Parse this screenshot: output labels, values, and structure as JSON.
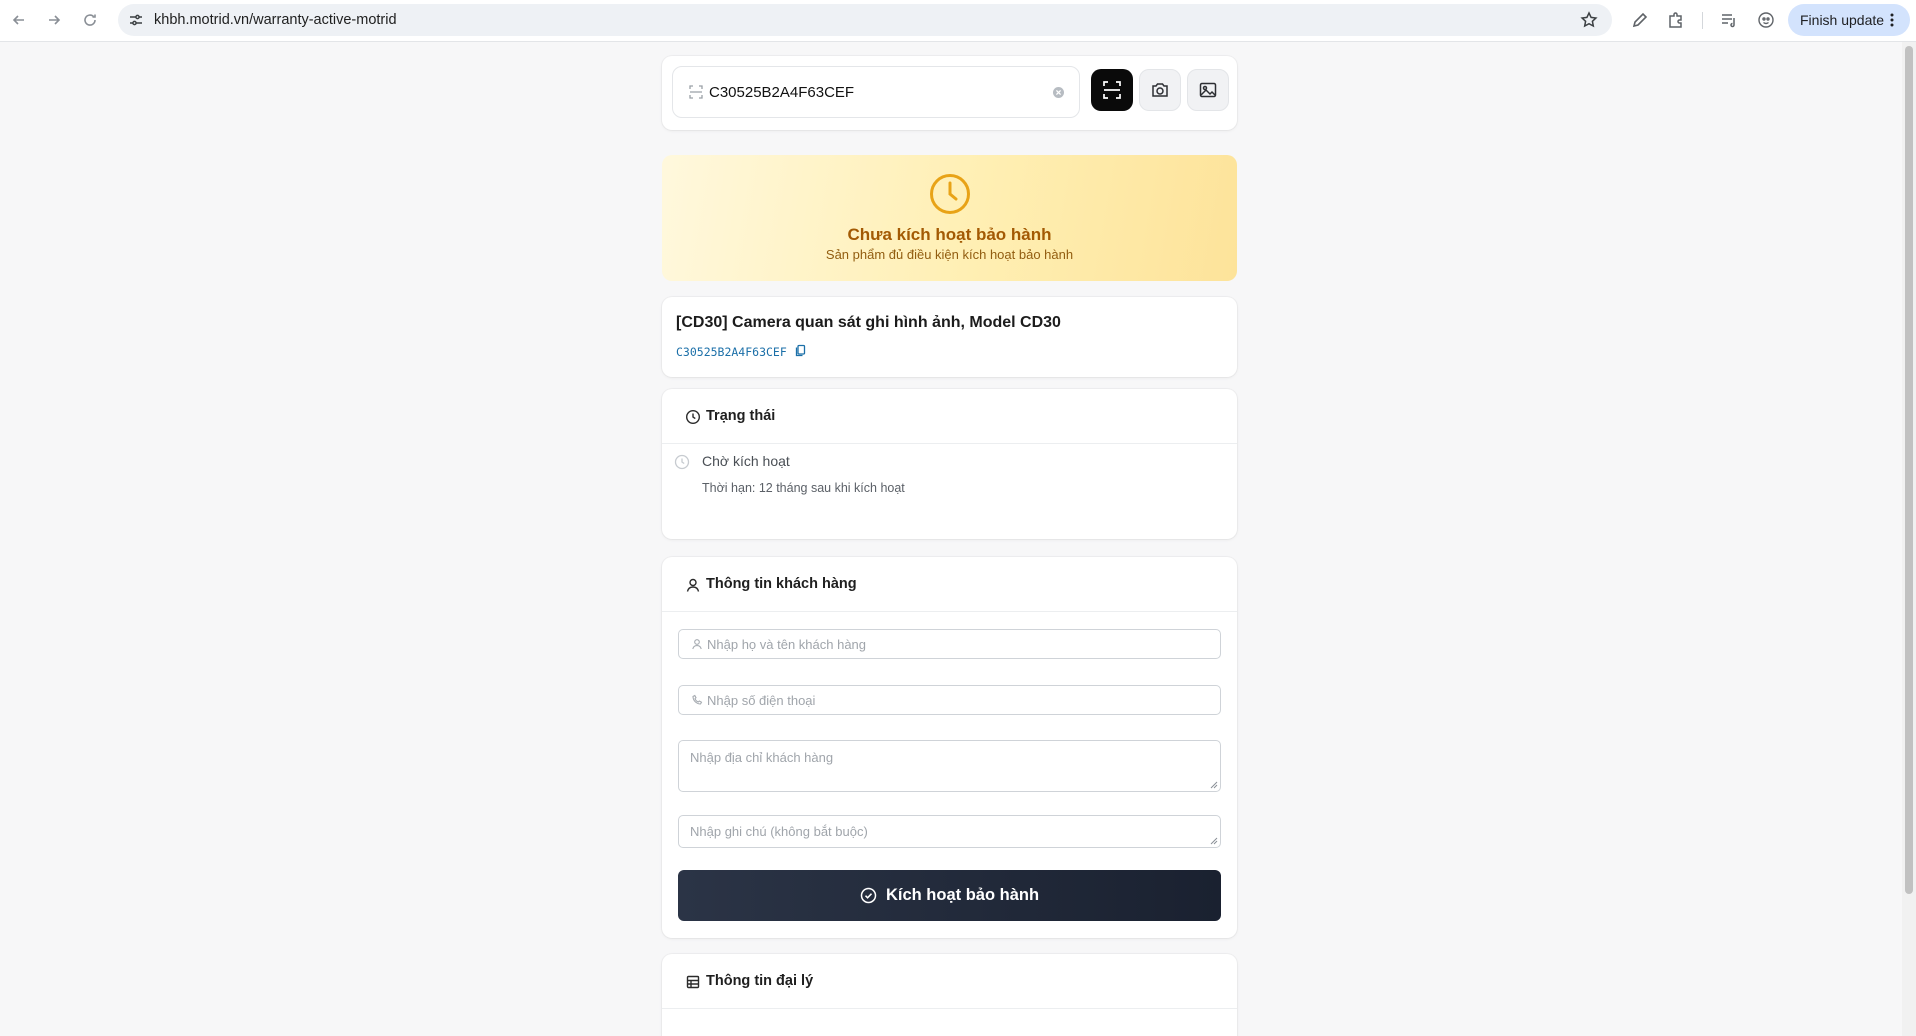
{
  "browser": {
    "url": "khbh.motrid.vn/warranty-active-motrid",
    "finish_update_label": "Finish update"
  },
  "search": {
    "value": "C30525B2A4F63CEF"
  },
  "status_banner": {
    "title": "Chưa kích hoạt bảo hành",
    "subtitle": "Sản phẩm đủ điều kiện kích hoạt bảo hành",
    "accent_color": "#e8a317"
  },
  "product": {
    "name": "[CD30] Camera quan sát ghi hình ảnh, Model CD30",
    "serial": "C30525B2A4F63CEF"
  },
  "status_section": {
    "heading": "Trạng thái",
    "item_title": "Chờ kích hoạt",
    "item_detail": "Thời hạn: 12 tháng sau khi kích hoạt"
  },
  "customer_section": {
    "heading": "Thông tin khách hàng",
    "name_placeholder": "Nhập họ và tên khách hàng",
    "phone_placeholder": "Nhập số điện thoại",
    "address_placeholder": "Nhập địa chỉ khách hàng",
    "note_placeholder": "Nhập ghi chú (không bắt buộc)",
    "submit_label": "Kích hoạt bảo hành"
  },
  "dealer_section": {
    "heading": "Thông tin đại lý"
  }
}
